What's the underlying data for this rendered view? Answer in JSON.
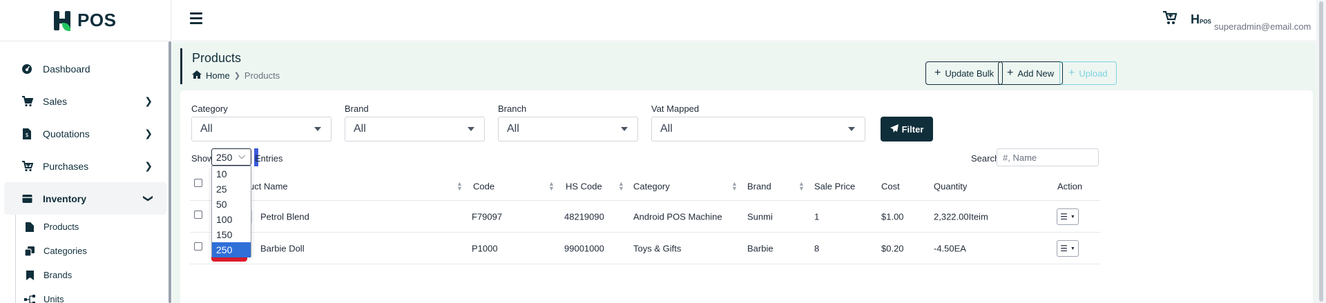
{
  "app": {
    "logo_text": "POS",
    "mini_logo": "POS",
    "user_email": "superadmin@email.com"
  },
  "colors": {
    "brand_dark": "#0f2e3a",
    "brand_green": "#22c55e",
    "page_bg": "#eef6f1",
    "highlight_blue": "#2f6fd8",
    "accent_red": "#e11d2e"
  },
  "sidebar": {
    "items": [
      {
        "label": "Dashboard",
        "icon": "dashboard-icon",
        "has_chevron": false
      },
      {
        "label": "Sales",
        "icon": "cart-icon",
        "has_chevron": true
      },
      {
        "label": "Quotations",
        "icon": "quotation-icon",
        "has_chevron": true
      },
      {
        "label": "Purchases",
        "icon": "cart-plus-icon",
        "has_chevron": true
      },
      {
        "label": "Inventory",
        "icon": "box-icon",
        "has_chevron": true,
        "expanded": true
      }
    ],
    "sub_items": [
      {
        "label": "Products",
        "icon": "file-icon"
      },
      {
        "label": "Categories",
        "icon": "copy-icon"
      },
      {
        "label": "Brands",
        "icon": "bookmark-icon"
      },
      {
        "label": "Units",
        "icon": "units-icon"
      }
    ]
  },
  "header": {
    "title": "Products",
    "breadcrumb": {
      "home": "Home",
      "current": "Products"
    },
    "buttons": {
      "update_bulk": "Update Bulk",
      "add_new": "Add New",
      "upload": "Upload"
    }
  },
  "filters": {
    "category": {
      "label": "Category",
      "value": "All"
    },
    "brand": {
      "label": "Brand",
      "value": "All"
    },
    "branch": {
      "label": "Branch",
      "value": "All"
    },
    "vat_mapped": {
      "label": "Vat Mapped",
      "value": "All"
    },
    "filter_button": "Filter"
  },
  "table_controls": {
    "show_label": "Show",
    "entries_value": "250",
    "entries_label": "Entries",
    "entries_options": [
      "10",
      "25",
      "50",
      "100",
      "150",
      "250"
    ],
    "search_label": "Search",
    "search_placeholder": "#, Name"
  },
  "table": {
    "columns": [
      "uct Name",
      "Code",
      "HS Code",
      "Category",
      "Brand",
      "Sale Price",
      "Cost",
      "Quantity",
      "Action"
    ],
    "rows": [
      {
        "name": "Petrol Blend",
        "code": "F79097",
        "hs_code": "48219090",
        "category": "Android POS Machine",
        "brand": "Sunmi",
        "sale_price": "1",
        "cost": "$1.00",
        "quantity": "2,322.00Iteim"
      },
      {
        "name": "Barbie Doll",
        "code": "P1000",
        "hs_code": "99001000",
        "category": "Toys & Gifts",
        "brand": "Barbie",
        "sale_price": "8",
        "cost": "$0.20",
        "quantity": "-4.50EA"
      }
    ]
  }
}
